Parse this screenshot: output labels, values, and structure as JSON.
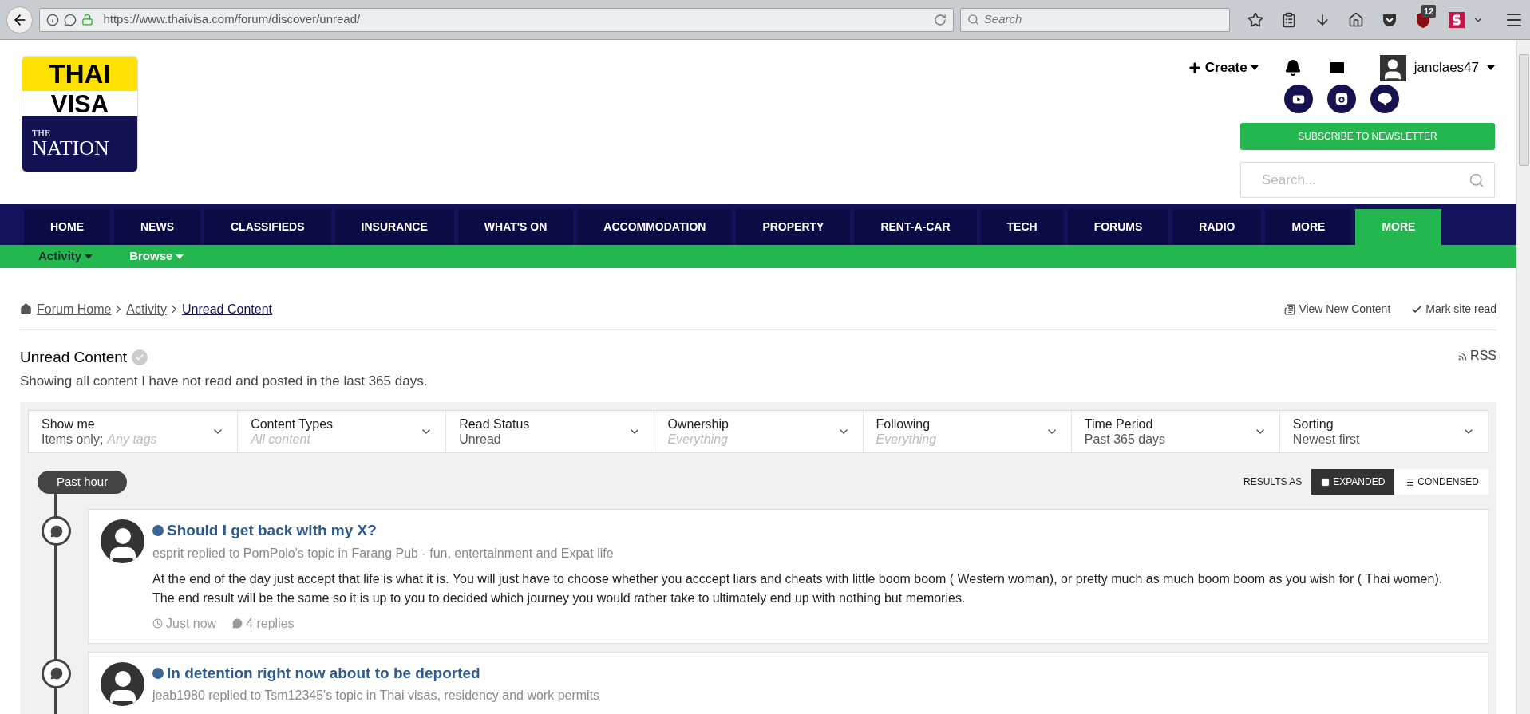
{
  "browser": {
    "url": "https://www.thaivisa.com/forum/discover/unread/",
    "search_placeholder": "Search",
    "addon_badge": "12"
  },
  "header": {
    "logo": {
      "lines": [
        "THAI",
        "VISA",
        "THE",
        "NATION"
      ]
    },
    "create": "Create",
    "username": "janclaes47",
    "subscribe": "SUBSCRIBE TO NEWSLETTER",
    "search_placeholder": "Search..."
  },
  "nav": [
    {
      "label": "HOME",
      "selected": false
    },
    {
      "label": "NEWS",
      "selected": false
    },
    {
      "label": "CLASSIFIEDS",
      "selected": false
    },
    {
      "label": "INSURANCE",
      "selected": false
    },
    {
      "label": "WHAT'S ON",
      "selected": false
    },
    {
      "label": "ACCOMMODATION",
      "selected": false
    },
    {
      "label": "PROPERTY",
      "selected": false
    },
    {
      "label": "RENT-A-CAR",
      "selected": false
    },
    {
      "label": "TECH",
      "selected": false
    },
    {
      "label": "FORUMS",
      "selected": false
    },
    {
      "label": "RADIO",
      "selected": false
    },
    {
      "label": "MORE",
      "selected": false
    },
    {
      "label": "MORE",
      "selected": true
    }
  ],
  "subnav": [
    {
      "label": "Activity",
      "selected": true
    },
    {
      "label": "Browse",
      "selected": false
    }
  ],
  "breadcrumb": [
    {
      "label": "Forum Home",
      "current": false
    },
    {
      "label": "Activity",
      "current": false
    },
    {
      "label": "Unread Content",
      "current": true
    }
  ],
  "actions": [
    "View New Content",
    "Mark site read"
  ],
  "page": {
    "title": "Unread Content",
    "subtitle": "Showing all content I have not read and posted in the last 365 days.",
    "rss": "RSS"
  },
  "filters": [
    {
      "label": "Show me",
      "value": "Items only;",
      "hint": "Any tags"
    },
    {
      "label": "Content Types",
      "hint": "All content"
    },
    {
      "label": "Read Status",
      "value": "Unread"
    },
    {
      "label": "Ownership",
      "hint": "Everything"
    },
    {
      "label": "Following",
      "hint": "Everything"
    },
    {
      "label": "Time Period",
      "value": "Past 365 days"
    },
    {
      "label": "Sorting",
      "value": "Newest first"
    }
  ],
  "timeline": {
    "group": "Past hour",
    "results_as": "RESULTS AS",
    "views": [
      {
        "label": "EXPANDED",
        "selected": true
      },
      {
        "label": "CONDENSED",
        "selected": false
      }
    ]
  },
  "posts": [
    {
      "title": "Should I get back with my X?",
      "unread": true,
      "meta": "esprit replied to PomPolo's topic in Farang Pub - fun, entertainment and Expat life",
      "body": "At the end of the day just accept that life is what it is. You will just have to choose whether you acccept liars and cheats with little boom boom ( Western woman), or pretty much as much boom boom as you wish for ( Thai women). The end result will be the same so it is up to you to decided which journey you would rather take to ultimately end up with nothing but memories.",
      "time": "Just now",
      "replies": "4 replies"
    },
    {
      "title": "In detention right now about to be deported",
      "unread": true,
      "meta": "jeab1980 replied to Tsm12345's topic in Thai visas, residency and work permits"
    }
  ]
}
